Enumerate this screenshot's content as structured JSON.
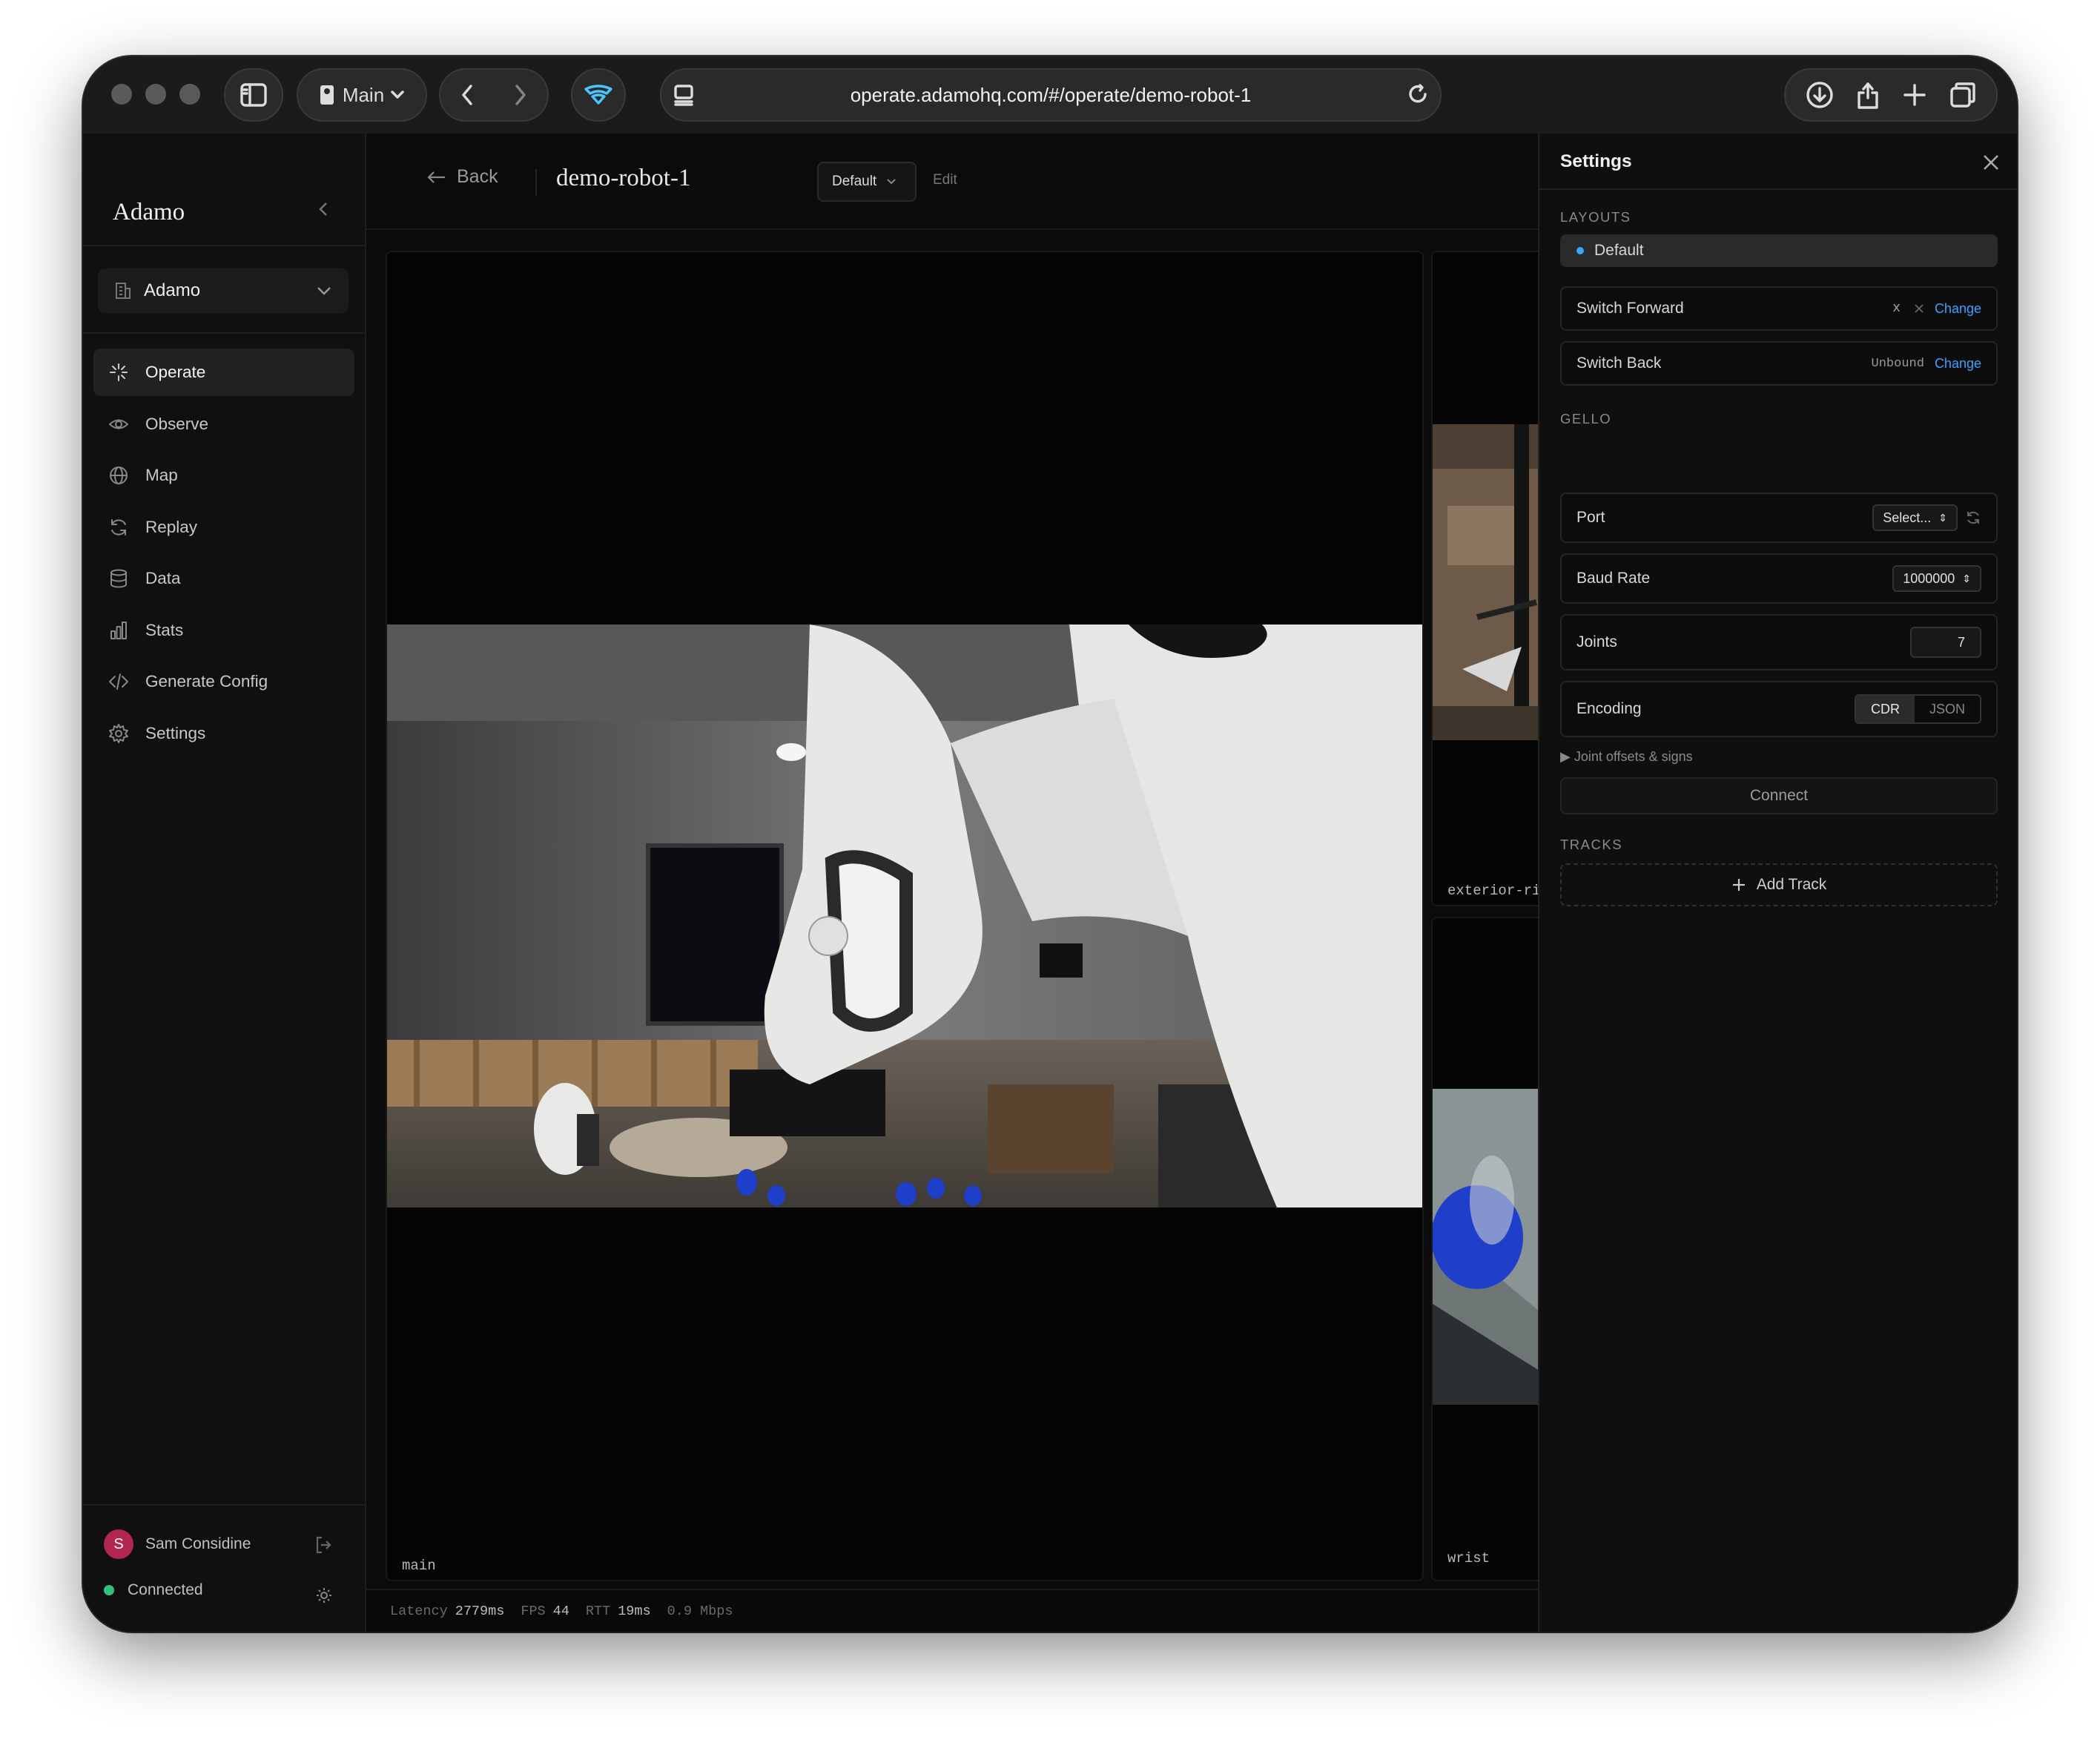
{
  "browser": {
    "profile_label": "Main",
    "url": "operate.adamohq.com/#/operate/demo-robot-1"
  },
  "sidebar": {
    "brand": "Adamo",
    "org": "Adamo",
    "items": [
      {
        "label": "Operate",
        "icon": "sparkle-icon",
        "active": true
      },
      {
        "label": "Observe",
        "icon": "eye-icon"
      },
      {
        "label": "Map",
        "icon": "globe-icon"
      },
      {
        "label": "Replay",
        "icon": "refresh-icon"
      },
      {
        "label": "Data",
        "icon": "database-icon"
      },
      {
        "label": "Stats",
        "icon": "bar-chart-icon"
      },
      {
        "label": "Generate Config",
        "icon": "code-icon"
      },
      {
        "label": "Settings",
        "icon": "gear-icon"
      }
    ],
    "user": {
      "initial": "S",
      "name": "Sam Considine"
    },
    "connection_status": "Connected"
  },
  "topbar": {
    "back_label": "Back",
    "robot_name": "demo-robot-1",
    "layout_selected": "Default",
    "edit_label": "Edit"
  },
  "panels": {
    "main_label": "main",
    "exterior_label": "exterior-ri",
    "wrist_label": "wrist"
  },
  "statusbar": {
    "latency_label": "Latency",
    "latency_value": "2779ms",
    "fps_label": "FPS",
    "fps_value": "44",
    "rtt_label": "RTT",
    "rtt_value": "19ms",
    "bandwidth": "0.9 Mbps"
  },
  "settings": {
    "title": "Settings",
    "layouts_section": "LAYOUTS",
    "layout_default": "Default",
    "switch_forward": {
      "label": "Switch Forward",
      "binding": "x",
      "action": "Change"
    },
    "switch_back": {
      "label": "Switch Back",
      "binding": "Unbound",
      "action": "Change"
    },
    "gello_section": "GELLO",
    "port": {
      "label": "Port",
      "value": "Select..."
    },
    "baud_rate": {
      "label": "Baud Rate",
      "value": "1000000"
    },
    "joints": {
      "label": "Joints",
      "value": "7"
    },
    "encoding": {
      "label": "Encoding",
      "options": [
        "CDR",
        "JSON"
      ],
      "selected": "CDR"
    },
    "joint_offsets": "▶ Joint offsets & signs",
    "connect_label": "Connect",
    "tracks_section": "TRACKS",
    "add_track_label": "Add Track"
  },
  "colors": {
    "accent": "#3aa3ff",
    "connected": "#2ec27e",
    "avatar": "#b3264f"
  }
}
